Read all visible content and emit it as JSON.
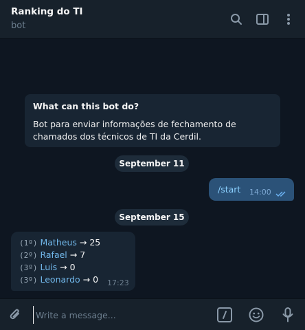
{
  "header": {
    "title": "Ranking do TI",
    "subtitle": "bot",
    "icons": [
      "search-icon",
      "sidebar-toggle-icon",
      "more-vertical-icon"
    ]
  },
  "chat": {
    "bot_info": {
      "title": "What can this bot do?",
      "description": "Bot para enviar informações de fechamento de chamados dos técnicos de TI da Cerdil."
    },
    "dates": [
      "September 11",
      "September 15"
    ],
    "messages": [
      {
        "direction": "outgoing",
        "text": "/start",
        "time": "14:00",
        "status": "read"
      },
      {
        "direction": "incoming",
        "time": "17:23",
        "ranking": [
          {
            "pos": "(1º)",
            "name": "Matheus",
            "arrow": "→",
            "value": "25"
          },
          {
            "pos": "(2º)",
            "name": "Rafael",
            "arrow": "→",
            "value": "7"
          },
          {
            "pos": "(3º)",
            "name": "Luis",
            "arrow": "→",
            "value": "0"
          },
          {
            "pos": "(3º)",
            "name": "Leonardo",
            "arrow": "→",
            "value": "0"
          }
        ]
      }
    ]
  },
  "composer": {
    "placeholder": "Write a message...",
    "icons": [
      "attach-icon",
      "bot-command-icon",
      "emoji-icon",
      "microphone-icon"
    ]
  },
  "colors": {
    "background": "#0e1621",
    "header": "#17212b",
    "incoming_bubble": "#182533",
    "outgoing_bubble": "#2b5278",
    "link": "#71b7ea"
  }
}
